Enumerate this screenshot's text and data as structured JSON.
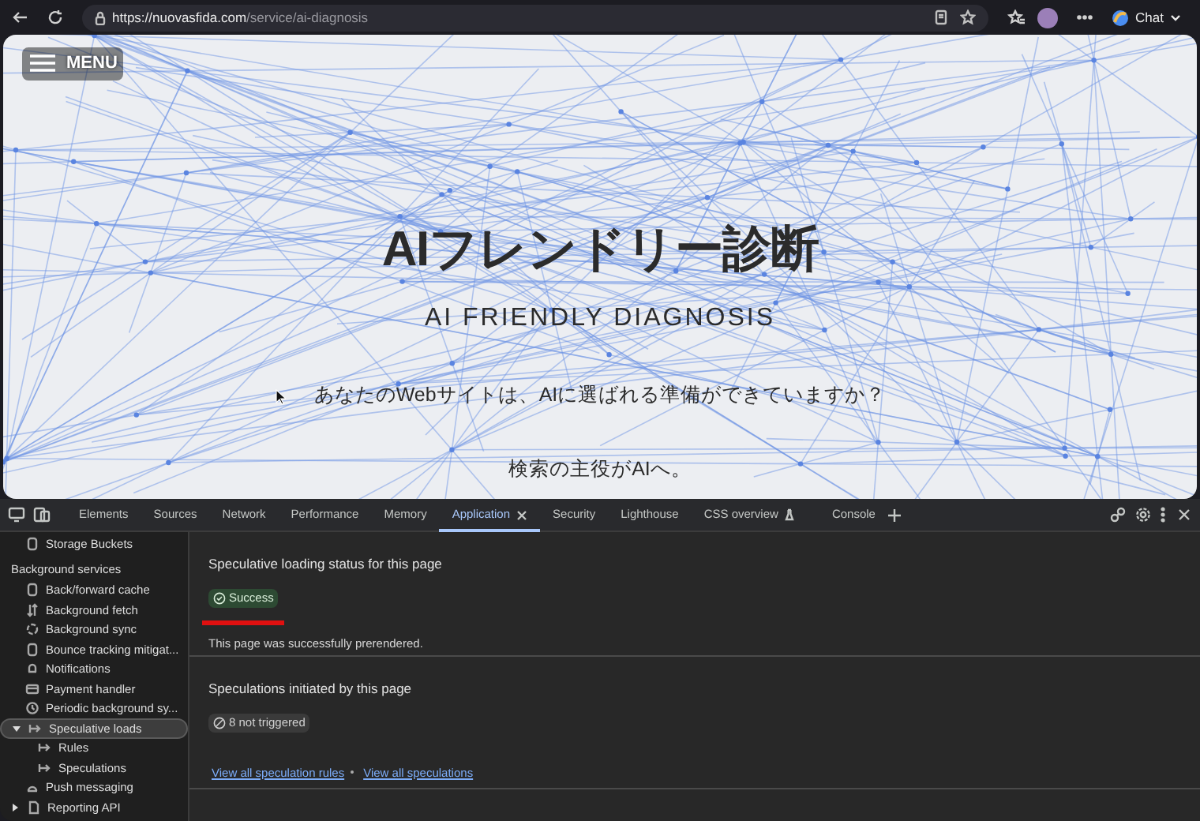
{
  "browser": {
    "url_host": "https://nuovasfida.com",
    "url_path": "/service/ai-diagnosis",
    "chat_label": "Chat"
  },
  "page": {
    "menu_label": "MENU",
    "title": "AIフレンドリー診断",
    "subtitle": "AI FRIENDLY DIAGNOSIS",
    "question": "あなたのWebサイトは、AIに選ばれる準備ができていますか？",
    "tagline": "検索の主役がAIへ。"
  },
  "devtools": {
    "tabs": [
      {
        "label": "Elements",
        "selected": false
      },
      {
        "label": "Sources",
        "selected": false
      },
      {
        "label": "Network",
        "selected": false
      },
      {
        "label": "Performance",
        "selected": false
      },
      {
        "label": "Memory",
        "selected": false
      },
      {
        "label": "Application",
        "selected": true
      },
      {
        "label": "Security",
        "selected": false
      },
      {
        "label": "Lighthouse",
        "selected": false
      },
      {
        "label": "CSS overview",
        "selected": false
      },
      {
        "label": "Console",
        "selected": false
      }
    ],
    "sidebar": [
      {
        "kind": "item",
        "label": "Storage Buckets",
        "selected": false
      },
      {
        "kind": "heading",
        "label": "Background services"
      },
      {
        "kind": "item",
        "label": "Back/forward cache",
        "selected": false
      },
      {
        "kind": "item",
        "label": "Background fetch",
        "selected": false
      },
      {
        "kind": "item",
        "label": "Background sync",
        "selected": false
      },
      {
        "kind": "item",
        "label": "Bounce tracking mitigat...",
        "selected": false
      },
      {
        "kind": "item",
        "label": "Notifications",
        "selected": false
      },
      {
        "kind": "item",
        "label": "Payment handler",
        "selected": false
      },
      {
        "kind": "item",
        "label": "Periodic background sy...",
        "selected": false
      },
      {
        "kind": "tree",
        "label": "Speculative loads",
        "selected": true,
        "expanded": true,
        "children": [
          {
            "kind": "item",
            "label": "Rules",
            "selected": false
          },
          {
            "kind": "item",
            "label": "Speculations",
            "selected": false
          }
        ]
      },
      {
        "kind": "item",
        "label": "Push messaging",
        "selected": false
      },
      {
        "kind": "tree",
        "label": "Reporting API",
        "selected": false,
        "expanded": false
      }
    ],
    "sections": [
      {
        "title": "Speculative loading status for this page",
        "badge": "Success",
        "kind": "success",
        "note": "This page was successfully prerendered."
      },
      {
        "title": "Speculations initiated by this page",
        "badge": "8 not triggered",
        "kind": "neutral",
        "links": [
          "View all speculation rules",
          "View all speculations"
        ]
      }
    ]
  }
}
